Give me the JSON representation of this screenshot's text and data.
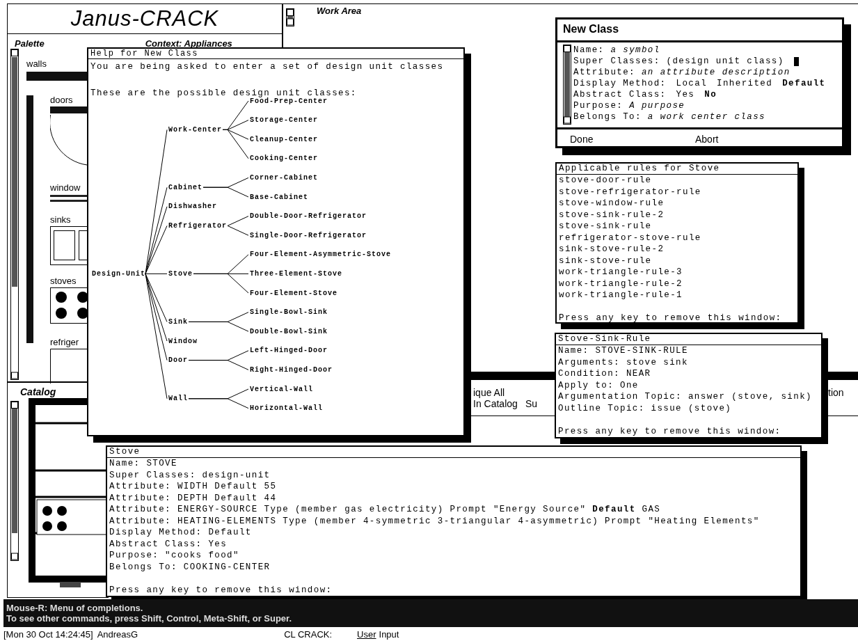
{
  "title_pane": {
    "title": "Janus-CRACK"
  },
  "palette": {
    "header": "Palette",
    "context": "Context: Appliances",
    "items": [
      {
        "label": "walls",
        "kind": "wall"
      },
      {
        "label": "doors",
        "kind": "door"
      },
      {
        "label": "window",
        "kind": "window"
      },
      {
        "label": "sinks",
        "kind": "sink"
      },
      {
        "label": "stoves",
        "kind": "stove"
      },
      {
        "label": "refriger",
        "kind": "refrigerator"
      }
    ]
  },
  "work_area": {
    "header": "Work Area"
  },
  "command_menu": {
    "items": [
      "ique All",
      "In Catalog",
      "Su",
      "tion"
    ]
  },
  "catalog": {
    "header": "Catalog"
  },
  "help_window": {
    "title": "Help for New Class",
    "lines": [
      "You are being asked to enter a set of design unit classes",
      "These are the possible design unit classes:"
    ],
    "tree": {
      "label": "Design-Unit",
      "children": [
        {
          "label": "Work-Center",
          "children": [
            {
              "label": "Food-Prep-Center"
            },
            {
              "label": "Storage-Center"
            },
            {
              "label": "Cleanup-Center"
            },
            {
              "label": "Cooking-Center"
            }
          ]
        },
        {
          "label": "Cabinet",
          "children": [
            {
              "label": "Corner-Cabinet"
            },
            {
              "label": "Base-Cabinet"
            }
          ]
        },
        {
          "label": "Dishwasher"
        },
        {
          "label": "Refrigerator",
          "children": [
            {
              "label": "Double-Door-Refrigerator"
            },
            {
              "label": "Single-Door-Refrigerator"
            }
          ]
        },
        {
          "label": "Stove",
          "children": [
            {
              "label": "Four-Element-Asymmetric-Stove"
            },
            {
              "label": "Three-Element-Stove"
            },
            {
              "label": "Four-Element-Stove"
            }
          ]
        },
        {
          "label": "Sink",
          "children": [
            {
              "label": "Single-Bowl-Sink"
            },
            {
              "label": "Double-Bowl-Sink"
            }
          ]
        },
        {
          "label": "Window"
        },
        {
          "label": "Door",
          "children": [
            {
              "label": "Left-Hinged-Door"
            },
            {
              "label": "Right-Hinged-Door"
            }
          ]
        },
        {
          "label": "Wall",
          "children": [
            {
              "label": "Vertical-Wall"
            },
            {
              "label": "Horizontal-Wall"
            }
          ]
        }
      ]
    }
  },
  "new_class_window": {
    "title": "New Class",
    "fields": [
      {
        "kind": "text",
        "text": "Name: *a symbol*"
      },
      {
        "kind": "text",
        "text": "Super Classes: (design unit class)",
        "cursor": true
      },
      {
        "kind": "text",
        "text": "Attribute: *an attribute description*"
      },
      {
        "kind": "choice",
        "label": "Display Method:",
        "options": [
          {
            "label": "Local",
            "selected": false
          },
          {
            "label": "Inherited",
            "selected": false
          },
          {
            "label": "Default",
            "selected": true
          }
        ]
      },
      {
        "kind": "choice",
        "label": "Abstract Class:",
        "options": [
          {
            "label": "Yes",
            "selected": false
          },
          {
            "label": "No",
            "selected": true
          }
        ]
      },
      {
        "kind": "text",
        "text": "Purpose: *A purpose*"
      },
      {
        "kind": "text",
        "text": "Belongs To: *a work center class*"
      }
    ],
    "buttons": [
      "Done",
      "Abort"
    ]
  },
  "rules_window": {
    "title": "Applicable rules for Stove",
    "lines": [
      "stove-door-rule",
      "stove-refrigerator-rule",
      "stove-window-rule",
      "stove-sink-rule-2",
      "stove-sink-rule",
      "refrigerator-stove-rule",
      "sink-stove-rule-2",
      "sink-stove-rule",
      "work-triangle-rule-3",
      "work-triangle-rule-2",
      "work-triangle-rule-1"
    ],
    "footer": "Press any key to remove this window:"
  },
  "rule_window": {
    "title": "Stove-Sink-Rule",
    "lines": [
      "Name: STOVE-SINK-RULE",
      "Arguments: stove sink",
      "Condition: NEAR",
      "Apply to: One",
      "Argumentation Topic: answer (stove, sink)",
      "Outline Topic: issue (stove)"
    ],
    "footer": "Press any key to remove this window:"
  },
  "stove_window": {
    "title": "Stove",
    "lines": [
      "Name: STOVE",
      "Super Classes: design-unit",
      "Attribute: WIDTH  Default 55",
      "Attribute: DEPTH  Default 44",
      "Attribute: ENERGY-SOURCE  Type (member gas electricity)  Prompt \"Energy Source\"  **Default** GAS",
      "Attribute: HEATING-ELEMENTS  Type (member 4-symmetric 3-triangular 4-asymmetric)  Prompt \"Heating Elements\"",
      "Display Method: Default",
      "Abstract Class: Yes",
      "Purpose: \"cooks food\"",
      "Belongs To: COOKING-CENTER"
    ],
    "footer": "Press any key to remove this window:"
  },
  "mouse_doc": {
    "lines": [
      "Mouse-R: Menu of completions.",
      "To see other commands, press Shift, Control, Meta-Shift, or Super."
    ]
  },
  "status_bar": {
    "time": "[Mon 30 Oct 14:24:45]",
    "user": "AndreasG",
    "package": "CL CRACK:",
    "mode": "User",
    "state": "Input"
  }
}
